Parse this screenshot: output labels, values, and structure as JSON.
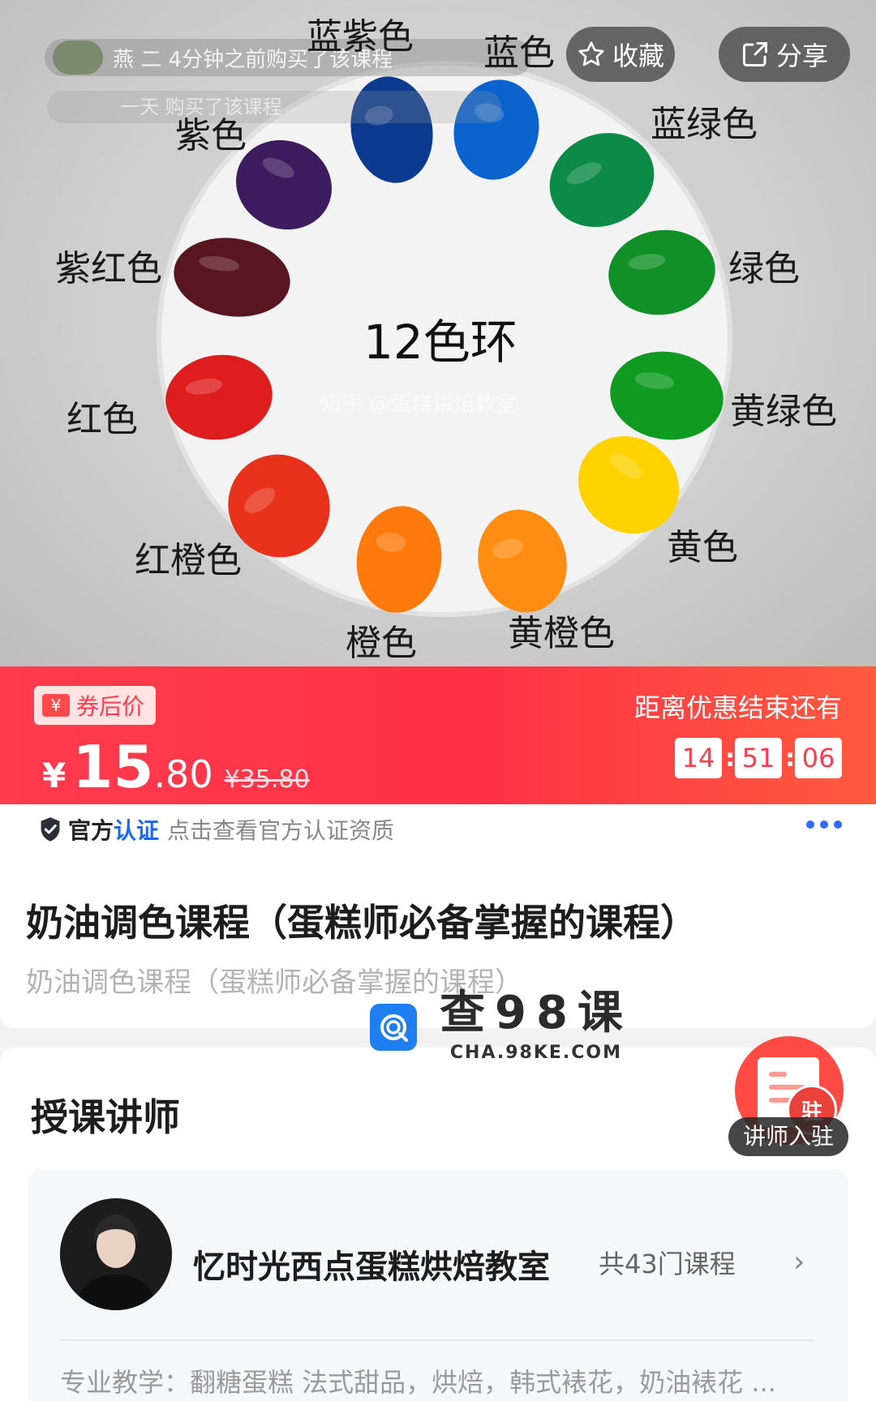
{
  "hero": {
    "ticker_text": "燕  二 4分钟之前购买了该课程",
    "ticker_line2": "一天     购买了该课程",
    "wheel_title": "12色环",
    "wheel_watermark": "知乎 @蛋糕烘焙教室",
    "color_labels": {
      "lanzi": "蓝紫色",
      "lan": "蓝色",
      "lanlv": "蓝绿色",
      "lv": "绿色",
      "huanglv": "黄绿色",
      "huang": "黄色",
      "huangcheng": "黄橙色",
      "cheng": "橙色",
      "hongcheng": "红橙色",
      "hong": "红色",
      "zihong": "紫红色",
      "zi": "紫色"
    },
    "swatch_colors": {
      "lanzi": "#0b3a8e",
      "lan": "#0a63cf",
      "lanlv": "#0c8a46",
      "lv": "#119027",
      "huanglv": "#0f9a20",
      "huang": "#ffd200",
      "huangcheng": "#ff8d12",
      "cheng": "#ff7a0c",
      "hongcheng": "#e8321c",
      "hong": "#de1e1e",
      "zihong": "#5a1620",
      "zi": "#3c1c5e"
    },
    "favorite_label": "收藏",
    "share_label": "分享"
  },
  "promo": {
    "coupon_icon": "¥",
    "coupon_label": "券后价",
    "currency": "¥",
    "price_int": "15",
    "price_dec": ".80",
    "original_price": "¥35.80",
    "countdown_label": "距离优惠结束还有",
    "hours": "14",
    "minutes": "51",
    "seconds": "06",
    "accent_color": "#ff3b4e"
  },
  "cert": {
    "label_a": "官方",
    "label_b": "认证",
    "link": "点击查看官方认证资质"
  },
  "course": {
    "title": "奶油调色课程（蛋糕师必备掌握的课程）",
    "subtitle": "奶油调色课程（蛋糕师必备掌握的课程）"
  },
  "watermark": {
    "main": "查98课",
    "url": "CHA.98KE.COM"
  },
  "instructor": {
    "section_title": "授课讲师",
    "join_stamp": "驻",
    "join_label": "讲师入驻",
    "name": "忆时光西点蛋糕烘焙教室",
    "course_count": "共43门课程",
    "tags": "专业教学：翻糖蛋糕 法式甜品，烘焙，韩式裱花，奶油裱花 ..."
  }
}
